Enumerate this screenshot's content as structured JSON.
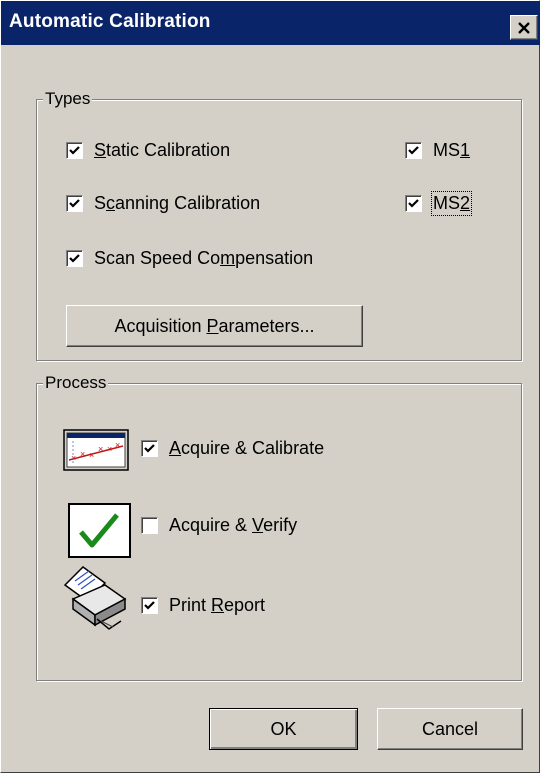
{
  "window": {
    "title": "Automatic Calibration",
    "close_glyph": "✕"
  },
  "types": {
    "label": "Types",
    "static_calibration": {
      "pre": "",
      "key": "S",
      "post": "tatic Calibration",
      "checked": true
    },
    "scanning_calibration": {
      "pre": "S",
      "key": "c",
      "post": "anning Calibration",
      "checked": true
    },
    "scan_speed": {
      "pre": "Scan Speed Co",
      "key": "m",
      "post": "pensation",
      "checked": true
    },
    "ms1": {
      "pre": "MS",
      "key": "1",
      "post": "",
      "checked": true
    },
    "ms2": {
      "pre": "MS",
      "key": "2",
      "post": "",
      "checked": true
    },
    "acquisition_button": {
      "pre": "Acquisition ",
      "key": "P",
      "post": "arameters..."
    }
  },
  "process": {
    "label": "Process",
    "acquire_calibrate": {
      "pre": "",
      "key": "A",
      "post": "cquire & Calibrate",
      "checked": true,
      "icon": "calibration-chart-icon"
    },
    "acquire_verify": {
      "pre": "Acquire & ",
      "key": "V",
      "post": "erify",
      "checked": false,
      "icon": "green-checkmark-icon"
    },
    "print_report": {
      "pre": "Print ",
      "key": "R",
      "post": "eport",
      "checked": true,
      "icon": "printer-icon"
    }
  },
  "buttons": {
    "ok": "OK",
    "cancel": "Cancel"
  },
  "colors": {
    "title_bar": "#0a246a",
    "dialog_face": "#d4d0c8",
    "check_green": "#1a8a1a"
  }
}
